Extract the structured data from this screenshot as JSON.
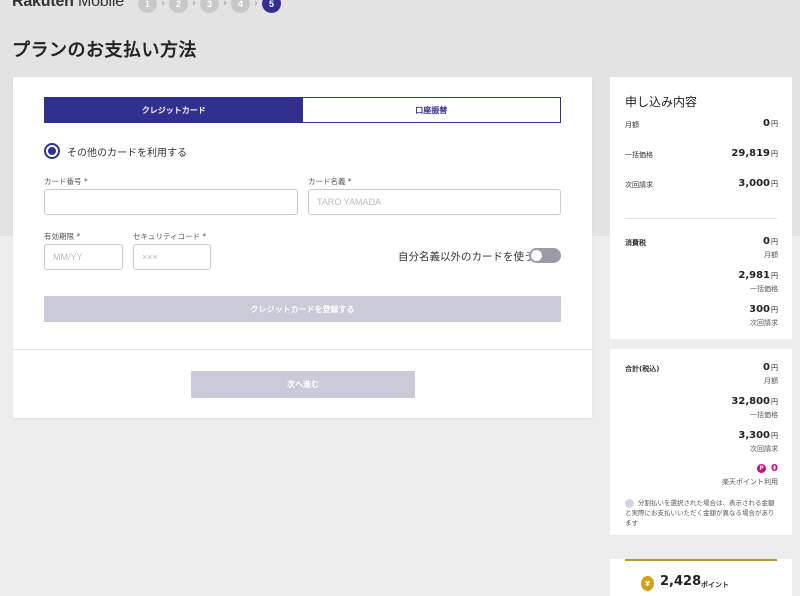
{
  "header": {
    "brand_bold": "Rakuten",
    "brand_light": " Mobile",
    "steps": [
      "1",
      "2",
      "3",
      "4",
      "5"
    ],
    "active_step": 5,
    "step_separator": "›"
  },
  "page_title": "プランのお支払い方法",
  "payment": {
    "tabs": [
      {
        "label": "クレジットカード",
        "active": true
      },
      {
        "label": "口座振替",
        "active": false
      }
    ],
    "radio_label": "その他のカードを利用する",
    "card_number": {
      "label": "カード番号 *",
      "value": "",
      "placeholder": ""
    },
    "card_name": {
      "label": "カード名義 *",
      "value": "",
      "placeholder": "TARO YAMADA"
    },
    "expiry": {
      "label": "有効期限 *",
      "value": "",
      "placeholder": "MM/YY"
    },
    "security_code": {
      "label": "セキュリティコード *",
      "value": "",
      "placeholder": "×××"
    },
    "toggle_label": "自分名義以外のカードを使う",
    "toggle_on": false,
    "register_button": "クレジットカードを登録する",
    "next_button": "次へ進む"
  },
  "summary": {
    "title": "申し込み内容",
    "rows1": [
      {
        "label": "月額",
        "value": "0",
        "unit": "円"
      },
      {
        "label": "一括価格",
        "value": "29,819",
        "unit": "円"
      },
      {
        "label": "次回請求",
        "value": "3,000",
        "unit": "円"
      }
    ],
    "tax": {
      "label": "消費税",
      "items": [
        {
          "value": "0",
          "unit": "円",
          "sub": "月額"
        },
        {
          "value": "2,981",
          "unit": "円",
          "sub": "一括価格"
        },
        {
          "value": "300",
          "unit": "円",
          "sub": "次回請求"
        }
      ]
    },
    "total": {
      "label": "合計(税込)",
      "items": [
        {
          "value": "0",
          "unit": "円",
          "sub": "月額"
        },
        {
          "value": "32,800",
          "unit": "円",
          "sub": "一括価格"
        },
        {
          "value": "3,300",
          "unit": "円",
          "sub": "次回請求"
        }
      ],
      "points_value": "0",
      "points_label": "楽天ポイント利用",
      "points_icon": "P"
    },
    "note": "分割払いを選択された場合は、表示される金額と実際にお支払いいただく金額が異なる場合があります",
    "earned_points": {
      "value": "2,428",
      "unit": "ポイント",
      "coin_glyph": "¥"
    }
  },
  "colors": {
    "accent": "#32308e",
    "disabled": "#cacad8",
    "points": "#e0007a",
    "gold": "#b8933e"
  }
}
